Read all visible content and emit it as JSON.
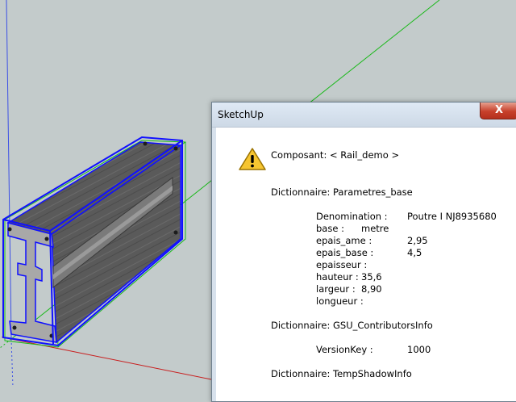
{
  "viewport": {
    "scene": "SketchUp 3D view with selected rail component (I-beam)",
    "colors": {
      "background": "#c3cbcb",
      "selection": "#1010ff",
      "axis_green": "#19b919",
      "axis_red": "#c81e1e",
      "axis_blue": "#3c50e6",
      "beam": "#5c5c5c"
    }
  },
  "dialog": {
    "title": "SketchUp",
    "close_label": "X",
    "icon": "warning-icon",
    "composant": "Composant: < Rail_demo >",
    "dictionaries": [
      {
        "header": "Dictionnaire: Parametres_base",
        "entries": [
          {
            "key": "Denomination :",
            "value": "Poutre I NJ8935680"
          },
          {
            "key": "base :",
            "value": "metre"
          },
          {
            "key": "epais_ame :",
            "value": "2,95"
          },
          {
            "key": "epais_base :",
            "value": "4,5"
          },
          {
            "key": "epaisseur :",
            "value": ""
          },
          {
            "key": "hauteur :",
            "value": "35,6"
          },
          {
            "key": "largeur :",
            "value": "8,90"
          },
          {
            "key": "longueur :",
            "value": ""
          }
        ]
      },
      {
        "header": "Dictionnaire: GSU_ContributorsInfo",
        "entries": [
          {
            "key": "VersionKey :",
            "value": "1000"
          }
        ]
      },
      {
        "header": "Dictionnaire: TempShadowInfo",
        "entries": []
      }
    ]
  }
}
